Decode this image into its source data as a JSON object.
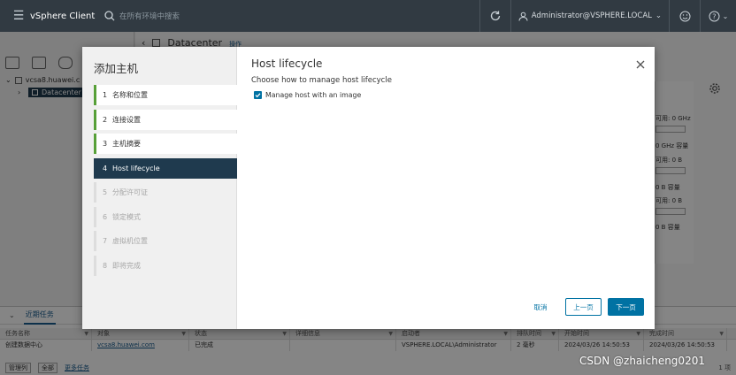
{
  "header": {
    "brand": "vSphere Client",
    "search_placeholder": "在所有环境中搜索",
    "user": "Administrator@VSPHERE.LOCAL"
  },
  "nav": {
    "tree": [
      {
        "label": "vcsa8.huawei.c"
      },
      {
        "label": "Datacenter"
      }
    ]
  },
  "content": {
    "title": "Datacenter",
    "actions_label": "操作"
  },
  "resource_panel": {
    "labels": [
      "可用: 0 GHz",
      "0 GHz 容量",
      "可用: 0 B",
      "0 B 容量",
      "可用: 0 B",
      "0 B 容量"
    ]
  },
  "tasks": {
    "tab_active": "近期任务",
    "columns": [
      "任务名称",
      "对象",
      "状态",
      "详细信息",
      "启动者",
      "排队时间",
      "开始时间",
      "完成时间"
    ],
    "rows": [
      [
        "创建数据中心",
        "vcsa8.huawei.com",
        "已完成",
        "",
        "VSPHERE.LOCAL\\Administrator",
        "2 毫秒",
        "2024/03/26 14:50:53",
        "2024/03/26 14:50:53"
      ]
    ],
    "footer_manage": "管理列",
    "footer_filter": "全部",
    "footer_more": "更多任务",
    "count": "1 项"
  },
  "wizard": {
    "title": "添加主机",
    "steps": [
      {
        "num": "1",
        "label": "名称和位置",
        "state": "done"
      },
      {
        "num": "2",
        "label": "连接设置",
        "state": "done"
      },
      {
        "num": "3",
        "label": "主机摘要",
        "state": "done"
      },
      {
        "num": "4",
        "label": "Host lifecycle",
        "state": "active"
      },
      {
        "num": "5",
        "label": "分配许可证",
        "state": "disabled"
      },
      {
        "num": "6",
        "label": "锁定模式",
        "state": "disabled"
      },
      {
        "num": "7",
        "label": "虚拟机位置",
        "state": "disabled"
      },
      {
        "num": "8",
        "label": "即将完成",
        "state": "disabled"
      }
    ],
    "page_title": "Host lifecycle",
    "subtitle": "Choose how to manage host lifecycle",
    "checkbox_label": "Manage host with an image",
    "checkbox_checked": true,
    "cancel_label": "取消",
    "back_label": "上一页",
    "next_label": "下一页"
  },
  "watermark": "CSDN @zhaicheng0201",
  "colors": {
    "header_bg": "#313a42",
    "accent": "#0072a3",
    "active_step": "#1f3a4e",
    "done_step_bar": "#57a038"
  }
}
